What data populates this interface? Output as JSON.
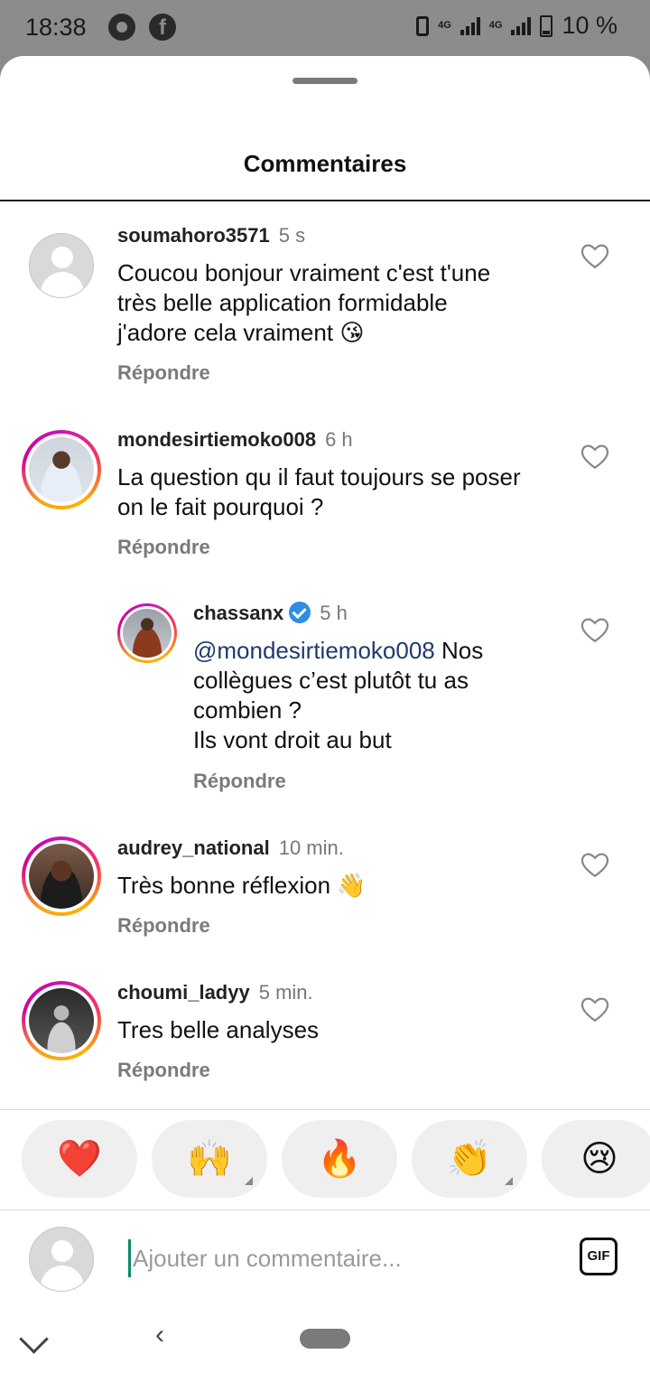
{
  "status_bar": {
    "time": "18:38",
    "network_1": "4G",
    "network_2": "4G",
    "battery": "10 %"
  },
  "sheet": {
    "title": "Commentaires"
  },
  "comments": [
    {
      "username": "soumahoro3571",
      "time": "5 s",
      "text": "Coucou bonjour vraiment c'est t'une\ntrès belle application formidable\nj'adore cela vraiment",
      "emoji": "😘",
      "reply": "Répondre"
    },
    {
      "username": "mondesirtiemoko008",
      "time": "6 h",
      "text": "La question qu il faut toujours se poser\non le fait pourquoi ?",
      "reply": "Répondre"
    },
    {
      "username": "chassanx",
      "time": "5 h",
      "mention": "@mondesirtiemoko008",
      "text": " Nos\ncollègues c’est plutôt tu as\ncombien ?\nIls vont droit au but",
      "reply": "Répondre"
    },
    {
      "username": "audrey_national",
      "time": "10 min.",
      "text": "Très bonne réflexion",
      "emoji": "👋",
      "reply": "Répondre"
    },
    {
      "username": "choumi_ladyy",
      "time": "5 min.",
      "text": "Tres belle analyses",
      "reply": "Répondre"
    }
  ],
  "quick_reactions": [
    "❤️",
    "🙌",
    "🔥",
    "👏",
    "😢"
  ],
  "composer": {
    "placeholder": "Ajouter un commentaire...",
    "gif_label": "GIF"
  },
  "colors": {
    "verified": "#2f8de4",
    "mention": "#1e3a6e",
    "heart_reaction": "#e0141e"
  }
}
